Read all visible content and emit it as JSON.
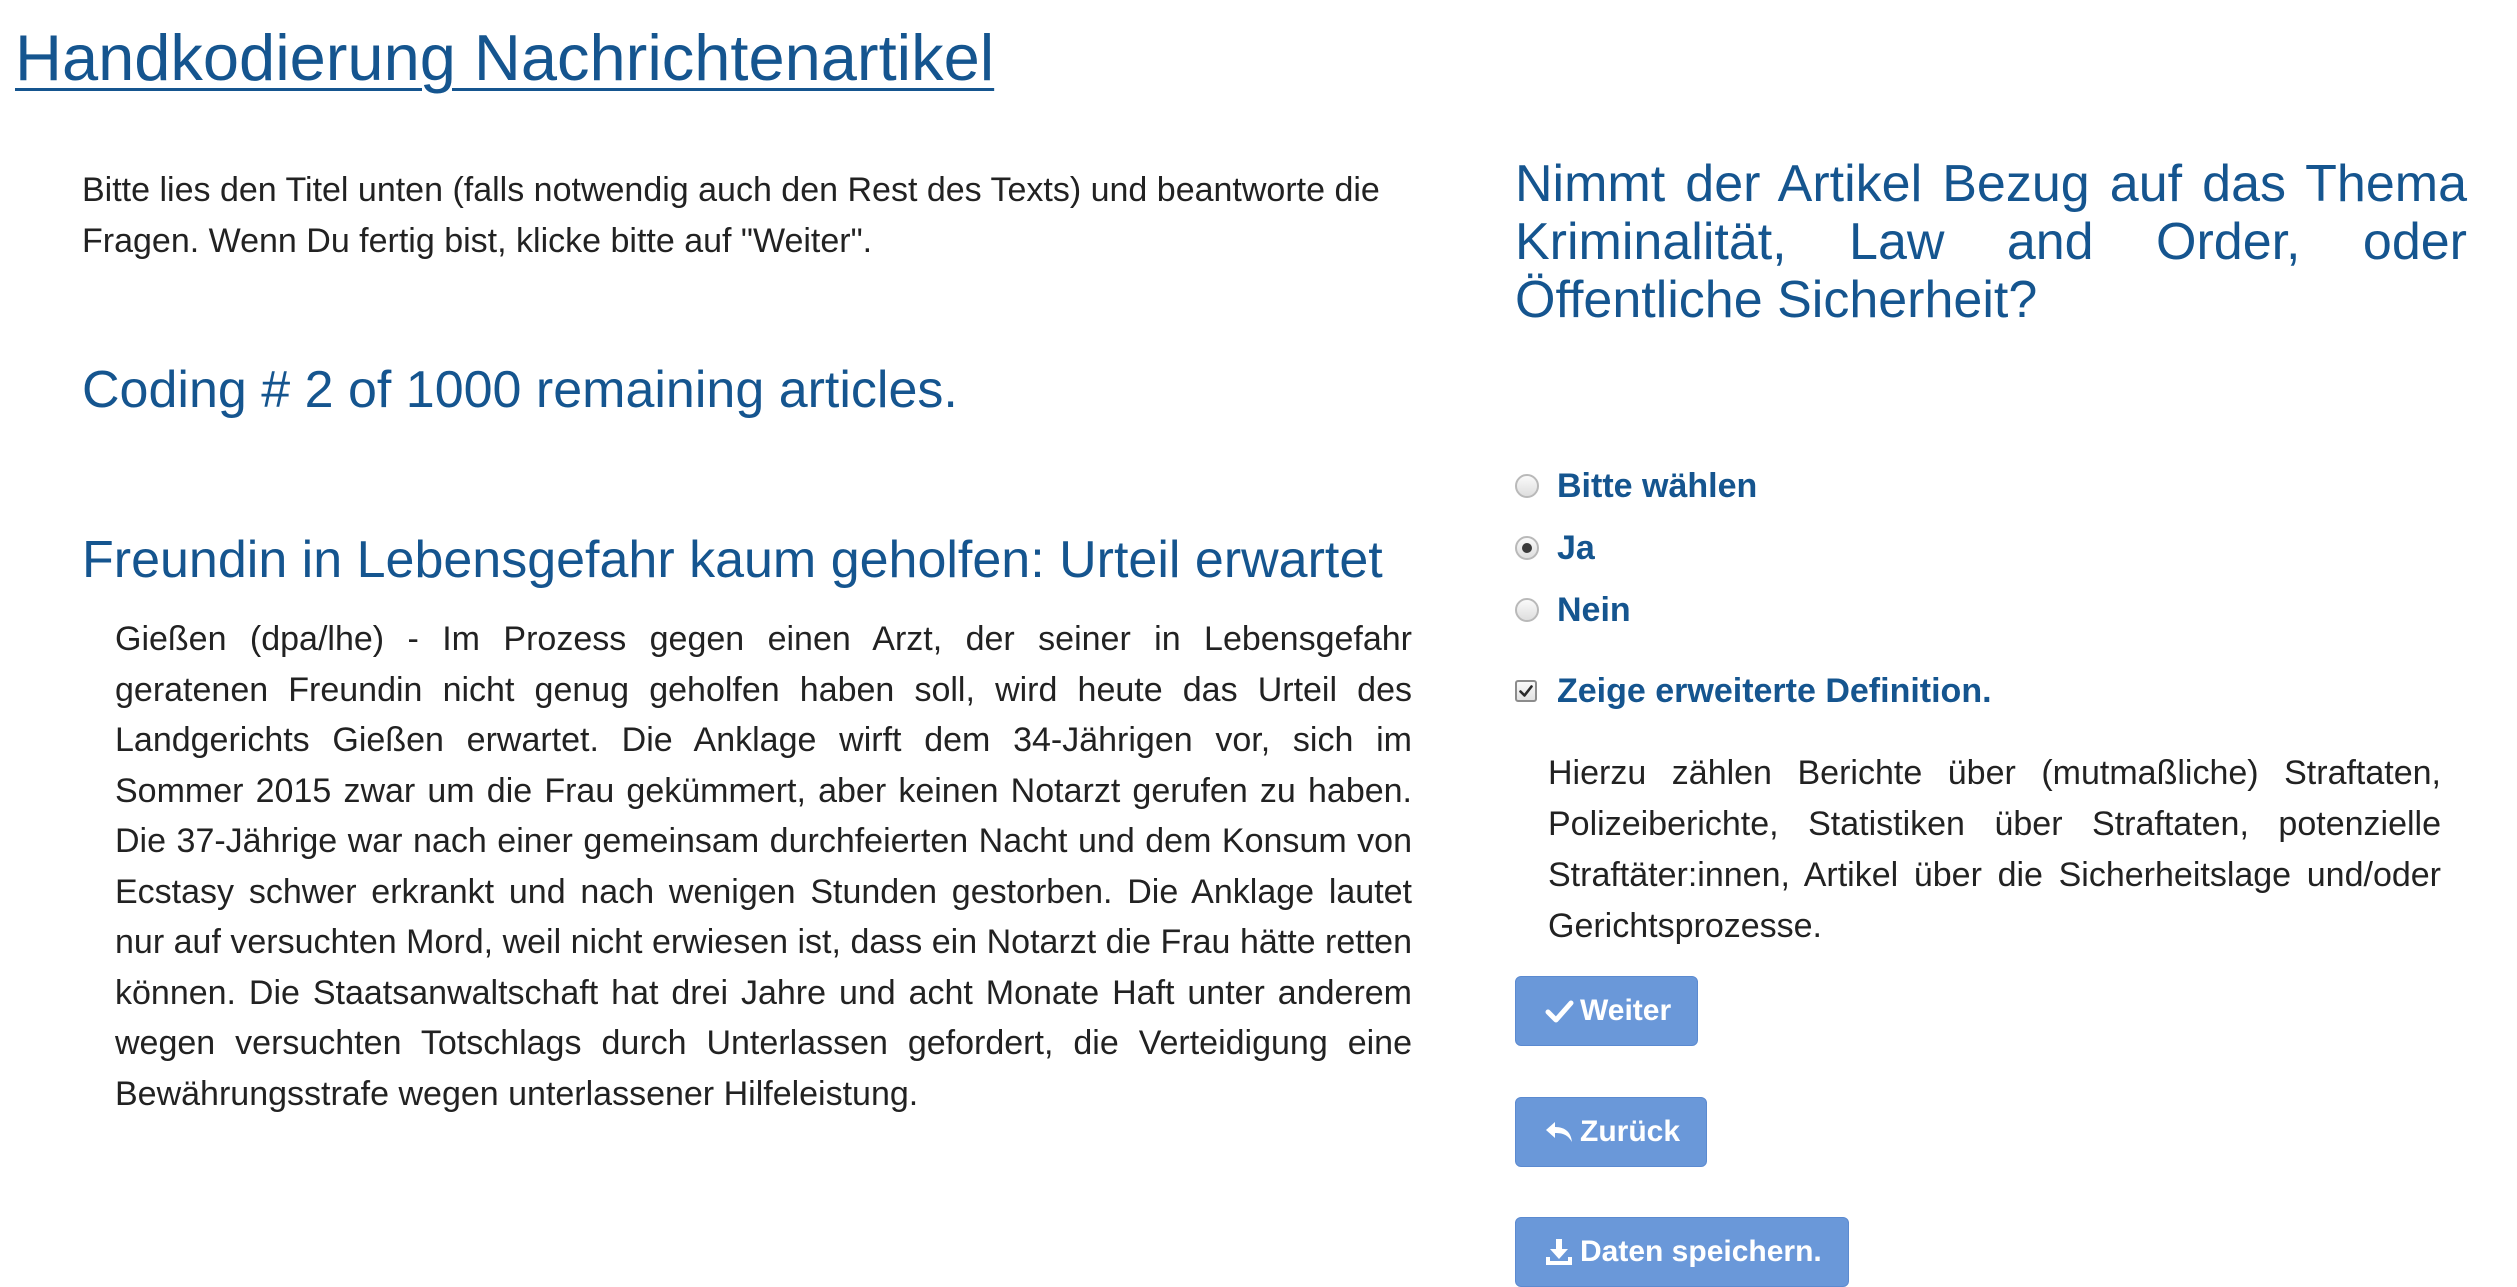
{
  "page": {
    "title": "Handkodierung Nachrichtenartikel"
  },
  "left": {
    "instructions": "Bitte lies den Titel unten (falls notwendig auch den Rest des Texts) und beantworte die Fragen. Wenn Du fertig bist, klicke bitte auf \"Weiter\".",
    "coding_count": "Coding # 2 of 1000 remaining articles.",
    "article_title": "Freundin in Lebensgefahr kaum geholfen: Urteil erwartet",
    "article_body": "Gießen (dpa/lhe) - Im Prozess gegen einen Arzt, der seiner in Lebensgefahr geratenen Freundin nicht genug geholfen haben soll, wird heute das Urteil des Landgerichts Gießen erwartet. Die Anklage wirft dem 34-Jährigen vor, sich im Sommer 2015 zwar um die Frau gekümmert, aber keinen Notarzt gerufen zu haben. Die 37-Jährige war nach einer gemeinsam durchfeierten Nacht und dem Konsum von Ecstasy schwer erkrankt und nach wenigen Stunden gestorben. Die Anklage lautet nur auf versuchten Mord, weil nicht erwiesen ist, dass ein Notarzt die Frau hätte retten können. Die Staatsanwaltschaft hat drei Jahre und acht Monate Haft unter anderem wegen versuchten Totschlags durch Unterlassen gefordert, die Verteidigung eine Bewährungsstrafe wegen unterlassener Hilfeleistung."
  },
  "right": {
    "question": "Nimmt der Artikel Bezug auf das Thema Kriminalität, Law and Order, oder Öffentliche Sicherheit?",
    "options": [
      {
        "label": "Bitte wählen",
        "checked": false
      },
      {
        "label": "Ja",
        "checked": true
      },
      {
        "label": "Nein",
        "checked": false
      }
    ],
    "show_definition": {
      "label": "Zeige erweiterte Definition.",
      "checked": true
    },
    "definition": "Hierzu zählen Berichte über (mutmaßliche) Straftaten, Polizeiberichte, Statistiken über Straftaten, potenzielle Straftäter:innen, Artikel über die Sicherheitslage und/oder Gerichtsprozesse.",
    "buttons": {
      "next_label": "Weiter",
      "back_label": "Zurück",
      "save_label": "Daten speichern."
    }
  },
  "colors": {
    "heading": "#15558f",
    "button": "#6a98d9",
    "text": "#222222"
  }
}
